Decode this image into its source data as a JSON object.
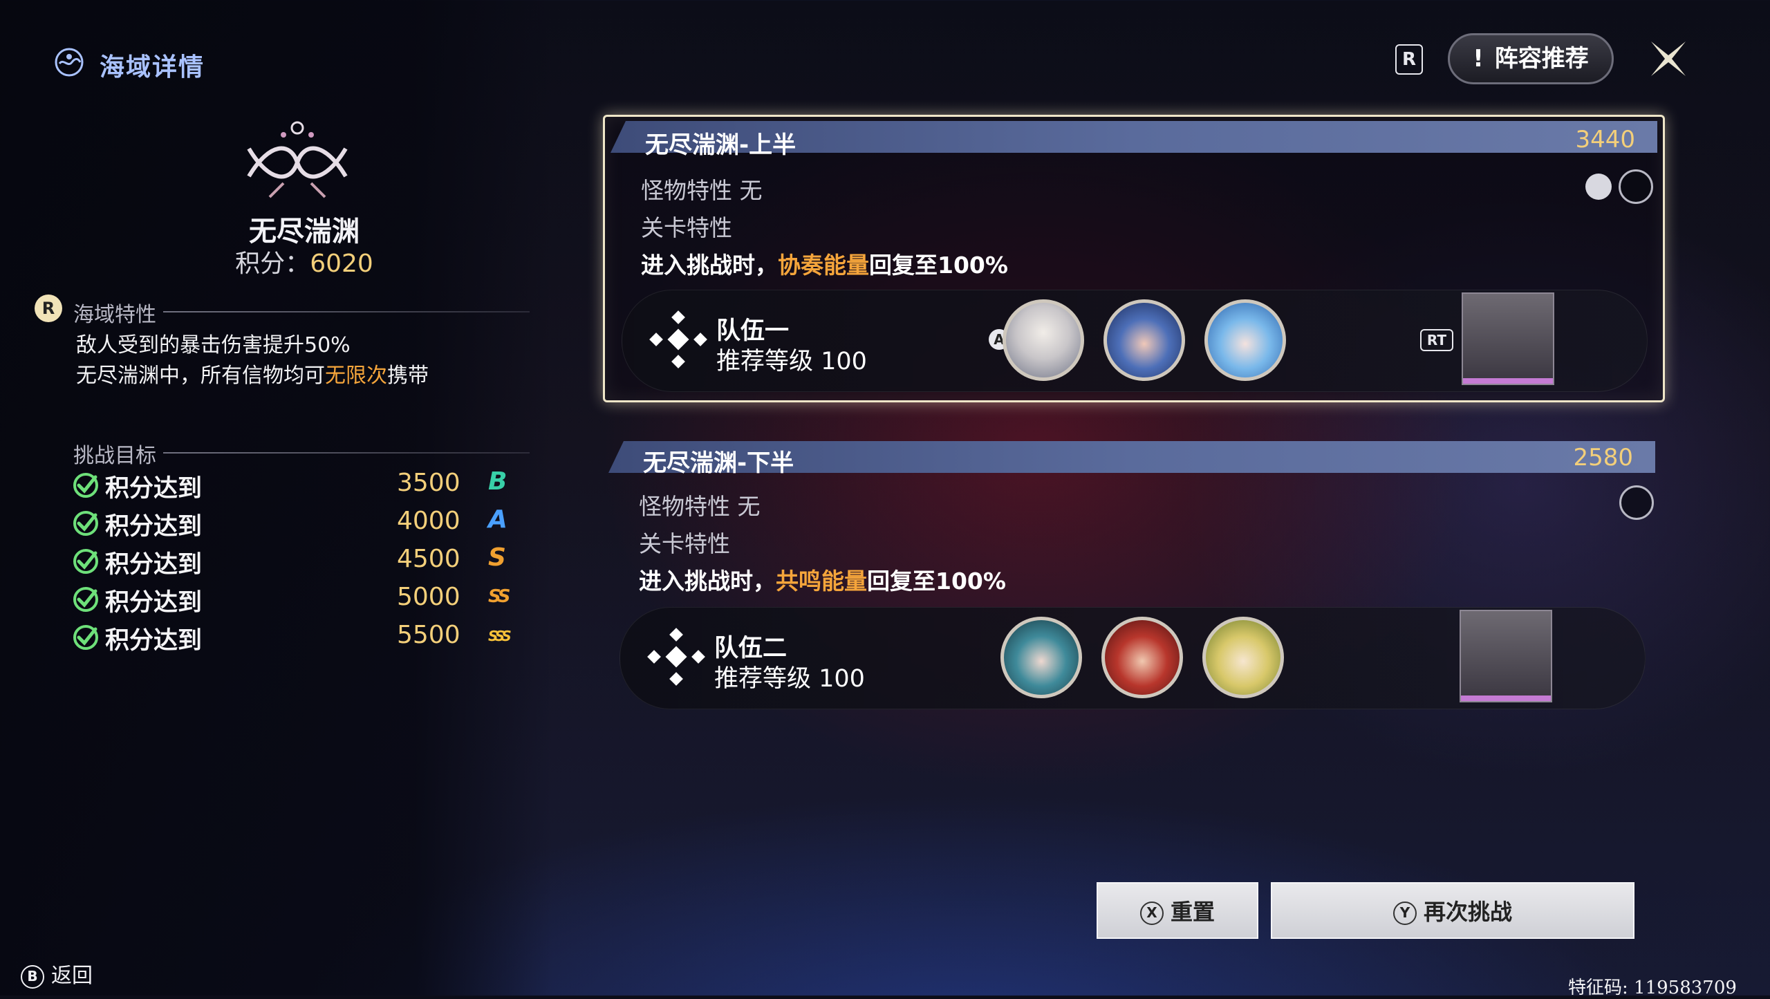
{
  "header": {
    "title": "海域详情",
    "icon": "sea-region-icon"
  },
  "abyss": {
    "name": "无尽湍渊",
    "score_label": "积分：",
    "score_value": "6020"
  },
  "sea_traits": {
    "title": "海域特性",
    "line1": "敌人受到的暴击伤害提升50%",
    "line2_pre": "无尽湍渊中，所有信物均可",
    "line2_highlight": "无限次",
    "line2_post": "携带"
  },
  "goals": {
    "title": "挑战目标",
    "items": [
      {
        "label": "积分达到",
        "value": "3500",
        "rank": "B",
        "color": "#38d0a8"
      },
      {
        "label": "积分达到",
        "value": "4000",
        "rank": "A",
        "color": "#4aa0ff"
      },
      {
        "label": "积分达到",
        "value": "4500",
        "rank": "S",
        "color": "#f0a030"
      },
      {
        "label": "积分达到",
        "value": "5000",
        "rank": "SS",
        "color": "#f0a030"
      },
      {
        "label": "积分达到",
        "value": "5500",
        "rank": "SSS",
        "color": "#f7c23a"
      }
    ]
  },
  "stages": [
    {
      "name": "无尽湍渊-上半",
      "score": "3440",
      "monster_trait": "怪物特性  无",
      "level_trait": "关卡特性",
      "effect_pre": "进入挑战时，",
      "effect_highlight": "协奏能量",
      "effect_post": "回复至100%",
      "team_name": "队伍一",
      "team_level": "推荐等级 100",
      "avatar_key": "A",
      "echo_key": "RT",
      "avatars": [
        "white-haired-character",
        "blue-hat-character",
        "blue-hooded-character"
      ]
    },
    {
      "name": "无尽湍渊-下半",
      "score": "2580",
      "monster_trait": "怪物特性  无",
      "level_trait": "关卡特性",
      "effect_pre": "进入挑战时，",
      "effect_highlight": "共鸣能量",
      "effect_post": "回复至100%",
      "team_name": "队伍二",
      "team_level": "推荐等级 100",
      "avatars": [
        "teal-haired-character",
        "red-haired-character",
        "green-bow-character"
      ]
    }
  ],
  "top_right": {
    "recommend_label": "阵容推荐",
    "recommend_mark": "!",
    "key_hint": "R"
  },
  "buttons": {
    "reset_key": "X",
    "reset_label": "重置",
    "retry_key": "Y",
    "retry_label": "再次挑战"
  },
  "footer": {
    "back_key": "B",
    "back_label": "返回",
    "feature_code": "特征码: 119583709"
  },
  "colors": {
    "accent_gold": "#f3cf7a",
    "highlight_orange": "#f5a53b",
    "title_blue": "#a9c2ff"
  }
}
